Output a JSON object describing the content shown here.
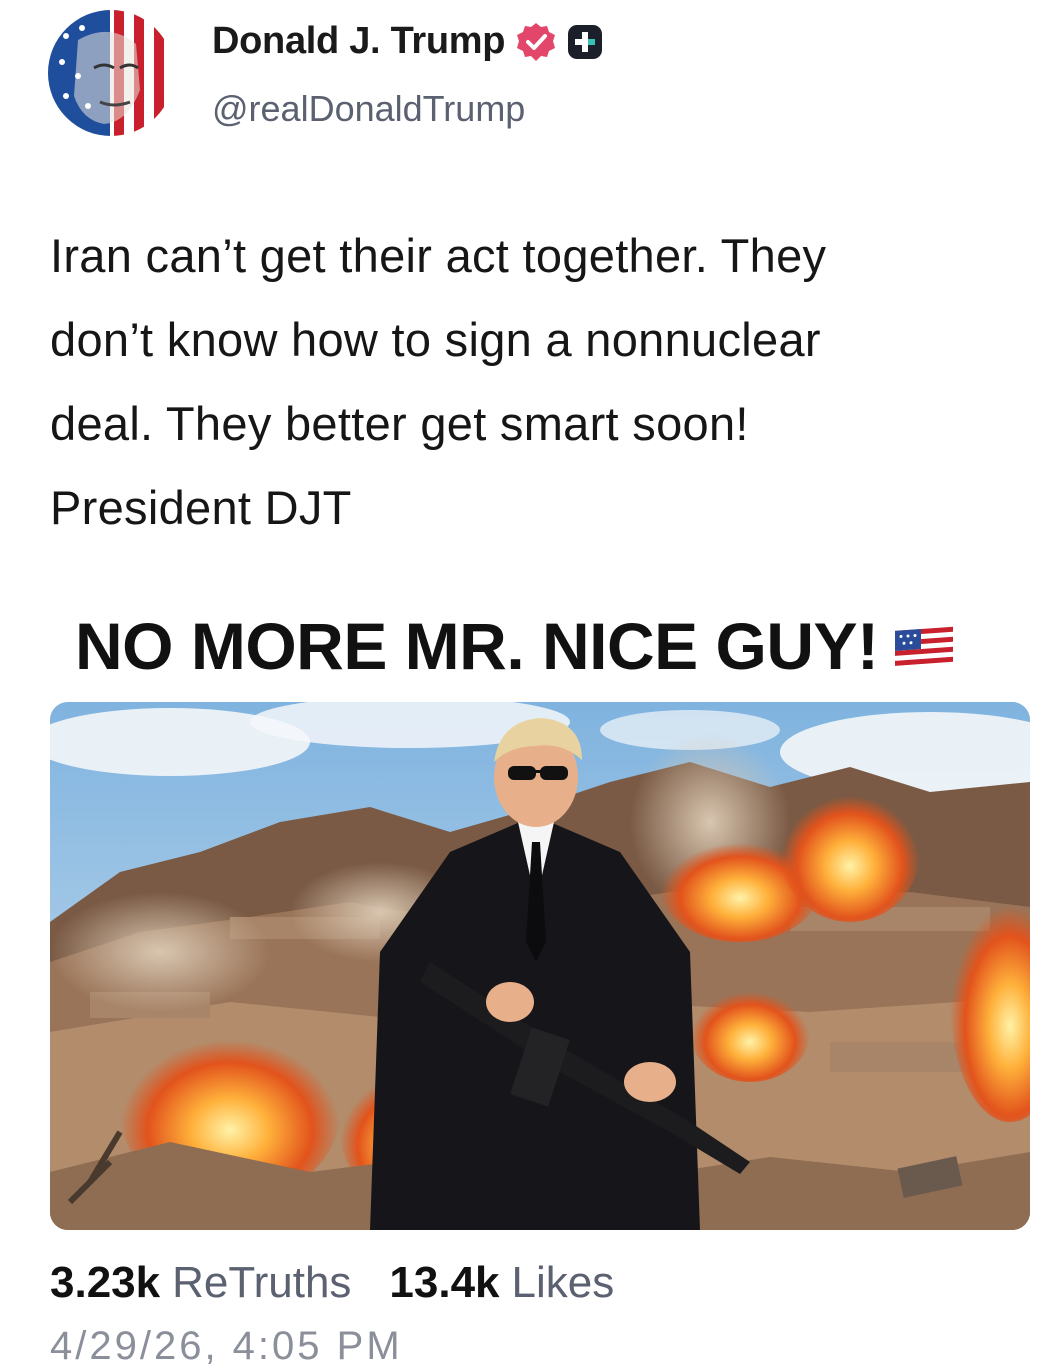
{
  "author": {
    "display_name": "Donald J. Trump",
    "handle": "@realDonaldTrump",
    "avatar_icon": "flag-face-avatar",
    "verified_icon": "verified-badge-icon",
    "verified_color": "#e2466a",
    "plus_icon": "plus-badge-icon"
  },
  "post": {
    "lines": [
      "Iran can’t get their act together. They",
      "don’t know how to sign a nonnuclear",
      "deal. They better get smart soon!",
      "President DJT"
    ]
  },
  "media": {
    "headline": "NO MORE MR. NICE GUY!",
    "headline_icon": "us-flag-emoji"
  },
  "stats": {
    "retruths_count": "3.23k",
    "retruths_label": "ReTruths",
    "likes_count": "13.4k",
    "likes_label": "Likes"
  },
  "timestamp": "4/29/26, 4:05 PM"
}
